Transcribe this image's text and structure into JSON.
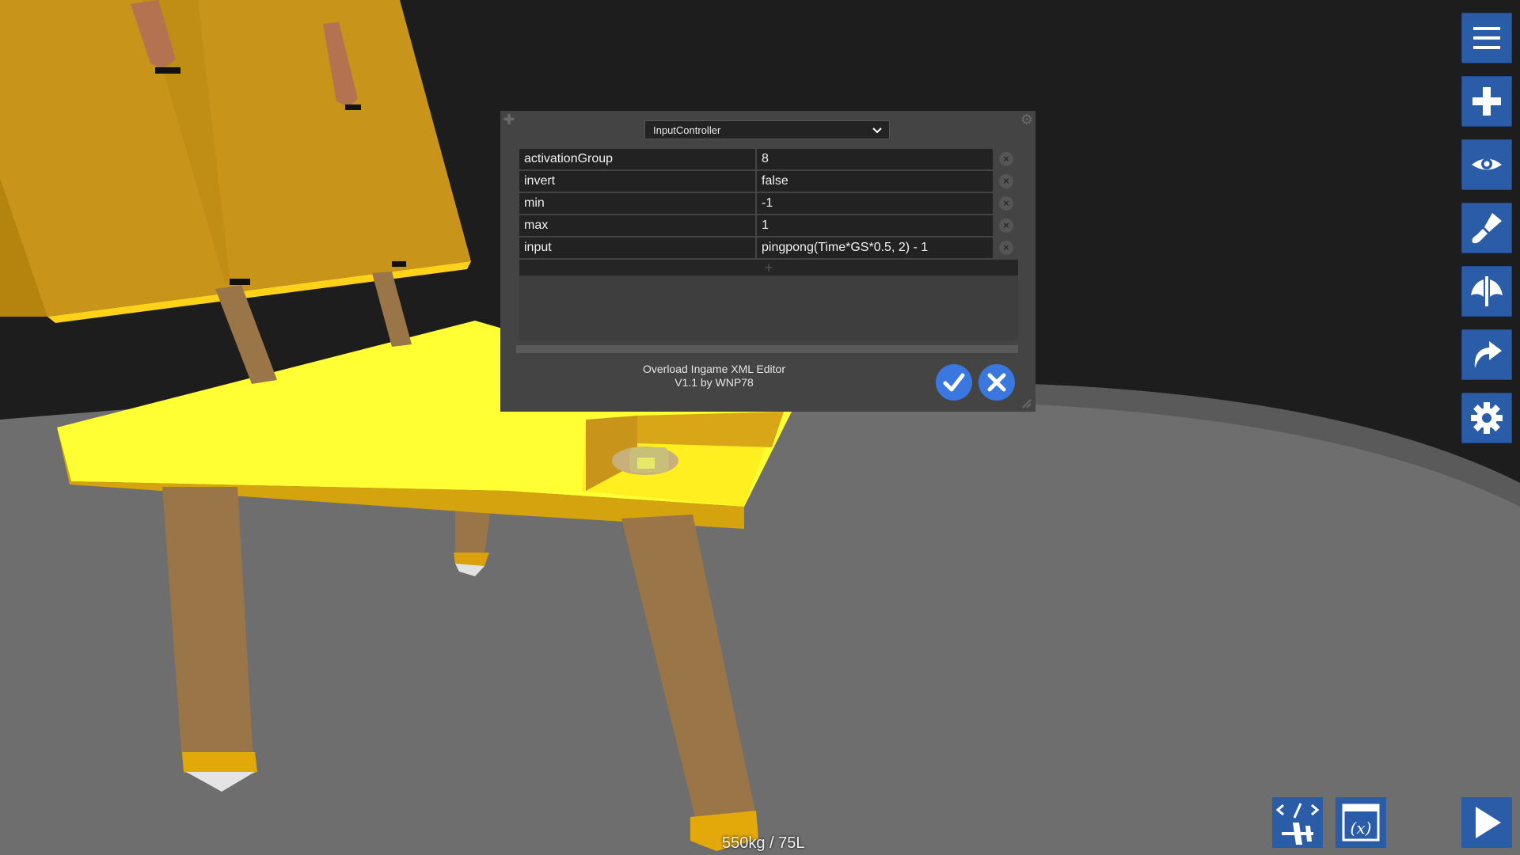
{
  "colors": {
    "toolbar_blue": "#2a5ca8",
    "confirm_blue": "#3a78e0",
    "panel_bg": "#444444",
    "field_bg": "#222222",
    "part_yellow": "#f2e21a",
    "part_gold": "#c9941a",
    "strut_brown": "#9a7548",
    "ground_gray": "#6e6e6e"
  },
  "toolbar": {
    "buttons": [
      {
        "icon": "menu-icon"
      },
      {
        "icon": "plus-icon"
      },
      {
        "icon": "eye-icon"
      },
      {
        "icon": "paintbrush-icon"
      },
      {
        "icon": "symmetry-icon"
      },
      {
        "icon": "redo-arrow-icon"
      },
      {
        "icon": "gear-icon"
      }
    ]
  },
  "editor": {
    "selected_type": "InputController",
    "rows": [
      {
        "key": "activationGroup",
        "value": "8"
      },
      {
        "key": "invert",
        "value": "false"
      },
      {
        "key": "min",
        "value": "-1"
      },
      {
        "key": "max",
        "value": "1"
      },
      {
        "key": "input",
        "value": "pingpong(Time*GS*0.5, 2) - 1"
      }
    ],
    "add_row_symbol": "+",
    "delete_symbol": "×",
    "footer_line1": "Overload Ingame XML Editor",
    "footer_line2": "V1.1 by WNP78"
  },
  "status": {
    "mass_readout": "550kg / 75L"
  },
  "bottom_bar": {
    "buttons": [
      {
        "icon": "xml-aircraft-icon"
      },
      {
        "icon": "variables-icon"
      },
      {
        "icon": "play-icon"
      }
    ]
  }
}
